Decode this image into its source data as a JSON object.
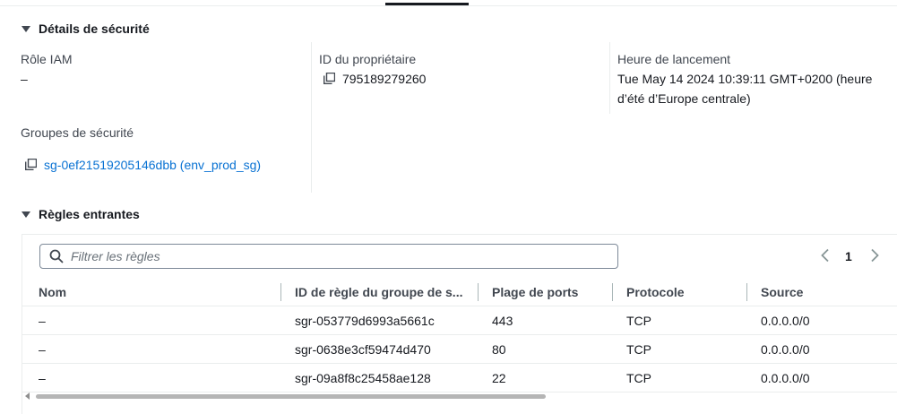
{
  "security_details": {
    "heading": "Détails de sécurité",
    "iam_role": {
      "label": "Rôle IAM",
      "value": "–"
    },
    "owner_id": {
      "label": "ID du propriétaire",
      "value": "795189279260"
    },
    "launch_time": {
      "label": "Heure de lancement",
      "line1": "Tue May 14 2024 10:39:11 GMT+0200 (heure",
      "line2": "d’été d’Europe centrale)"
    },
    "security_groups": {
      "label": "Groupes de sécurité",
      "value": "sg-0ef21519205146dbb (env_prod_sg)"
    }
  },
  "inbound_rules": {
    "heading": "Règles entrantes",
    "filter_placeholder": "Filtrer les règles",
    "page": "1",
    "columns": [
      "Nom",
      "ID de règle du groupe de s...",
      "Plage de ports",
      "Protocole",
      "Source"
    ],
    "rows": [
      {
        "name": "–",
        "rule_id": "sgr-053779d6993a5661c",
        "ports": "443",
        "protocol": "TCP",
        "source": "0.0.0.0/0"
      },
      {
        "name": "–",
        "rule_id": "sgr-0638e3cf59474d470",
        "ports": "80",
        "protocol": "TCP",
        "source": "0.0.0.0/0"
      },
      {
        "name": "–",
        "rule_id": "sgr-09a8f8c25458ae128",
        "ports": "22",
        "protocol": "TCP",
        "source": "0.0.0.0/0"
      }
    ]
  },
  "icons": {
    "caret": "caret-down-icon",
    "copy": "copy-icon",
    "search": "search-icon",
    "prev": "chevron-left-icon",
    "next": "chevron-right-icon"
  },
  "colors": {
    "link": "#0972d3",
    "text": "#16191f",
    "muted": "#414750",
    "border": "#eaeded"
  }
}
